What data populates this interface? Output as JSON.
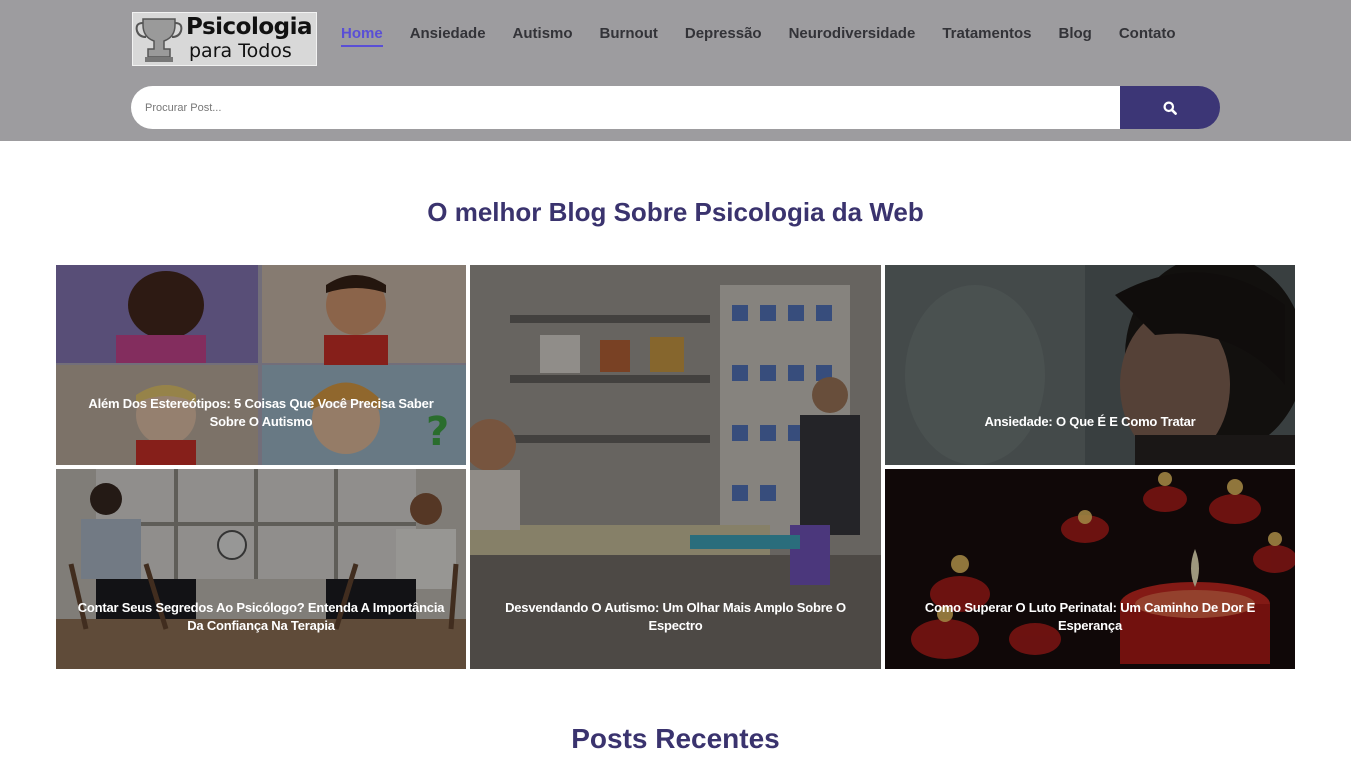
{
  "header": {
    "logo": {
      "line1": "Psicologia",
      "line2": "para Todos"
    },
    "nav": [
      {
        "label": "Home",
        "active": true
      },
      {
        "label": "Ansiedade"
      },
      {
        "label": "Autismo"
      },
      {
        "label": "Burnout"
      },
      {
        "label": "Depressão"
      },
      {
        "label": "Neurodiversidade"
      },
      {
        "label": "Tratamentos"
      },
      {
        "label": "Blog"
      },
      {
        "label": "Contato"
      }
    ],
    "search": {
      "placeholder": "Procurar Post...",
      "value": "",
      "button_icon": "search-icon"
    }
  },
  "main": {
    "title": "O melhor Blog Sobre Psicologia da Web",
    "posts": [
      {
        "title": "Além Dos Estereótipos: 5 Coisas Que Você Precisa Saber Sobre O Autismo"
      },
      {
        "title": "Desvendando O Autismo: Um Olhar Mais Amplo Sobre O Espectro"
      },
      {
        "title": "Ansiedade: O Que É E Como Tratar"
      },
      {
        "title": "Contar Seus Segredos Ao Psicólogo? Entenda A Importância Da Confiança Na Terapia"
      },
      {
        "title": "Como Superar O Luto Perinatal: Um Caminho De Dor E Esperança"
      }
    ],
    "recent_title": "Posts Recentes"
  },
  "colors": {
    "header_bg": "#9d9c9f",
    "accent": "#5a4fd6",
    "heading": "#3a336e",
    "search_button": "#3c3676"
  }
}
